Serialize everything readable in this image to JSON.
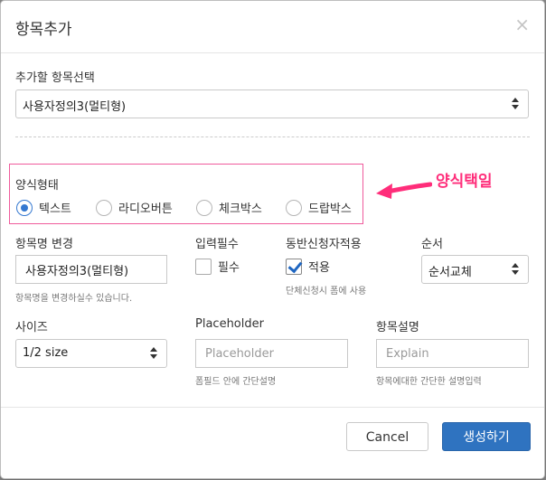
{
  "modal": {
    "title": "항목추가",
    "close_glyph": "×"
  },
  "item_select": {
    "label": "추가할 항목선택",
    "value": "사용자정의3(멀티형)"
  },
  "form_type": {
    "label": "양식형태",
    "options": [
      {
        "label": "텍스트",
        "selected": true
      },
      {
        "label": "라디오버튼",
        "selected": false
      },
      {
        "label": "체크박스",
        "selected": false
      },
      {
        "label": "드랍박스",
        "selected": false
      }
    ],
    "annotation": "양식택일",
    "annotation_color": "#ff2d7a"
  },
  "name_change": {
    "label": "항목명 변경",
    "value": "사용자정의3(멀티형)",
    "help": "항목명을 변경하실수 있습니다."
  },
  "required": {
    "label": "입력필수",
    "checkbox_label": "필수",
    "checked": false
  },
  "companion": {
    "label": "동반신청자적용",
    "checkbox_label": "적용",
    "checked": true,
    "help": "단체신청시 폼에 사용"
  },
  "order": {
    "label": "순서",
    "value": "순서교체"
  },
  "size": {
    "label": "사이즈",
    "value": "1/2 size"
  },
  "placeholder_field": {
    "label": "Placeholder",
    "placeholder": "Placeholder",
    "help": "폼필드 안에 간단설명"
  },
  "description": {
    "label": "항목설명",
    "placeholder": "Explain",
    "help": "항목에대한 간단한 설명입력"
  },
  "footer": {
    "cancel_label": "Cancel",
    "submit_label": "생성하기"
  },
  "colors": {
    "primary": "#2f73c0",
    "highlight_box": "#ef5b9c"
  }
}
